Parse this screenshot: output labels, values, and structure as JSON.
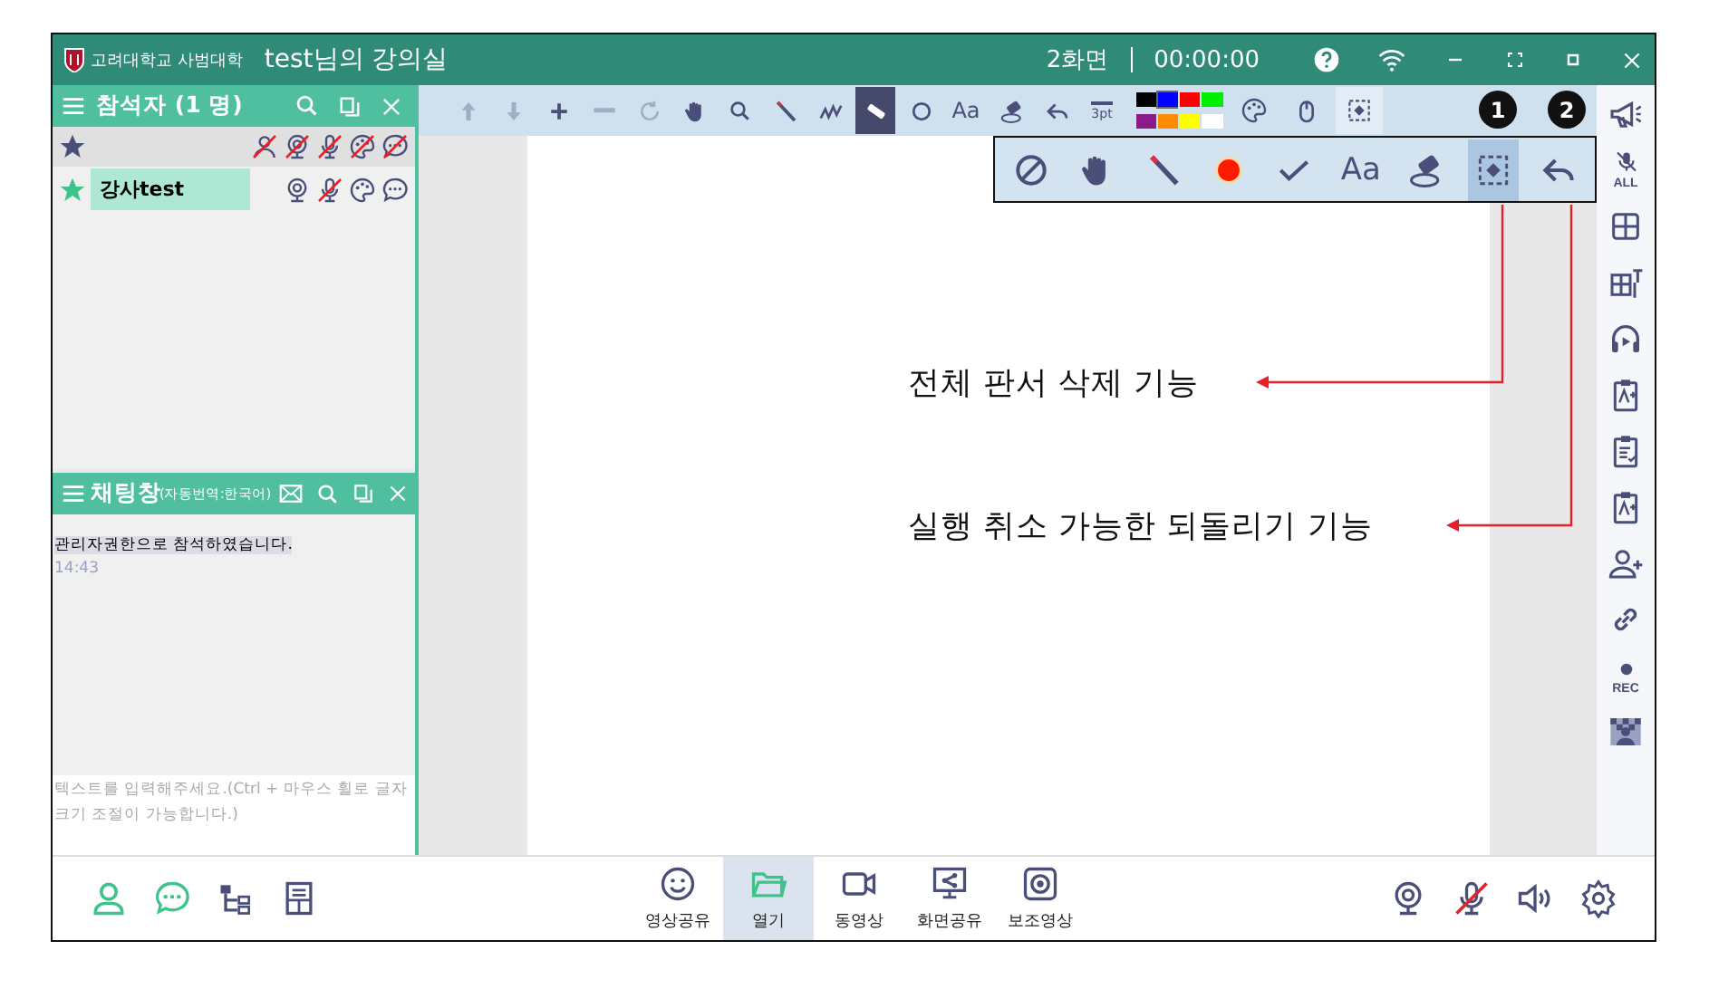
{
  "window": {
    "logo_text": "고려대학교 사범대학",
    "title": "test님의 강의실",
    "screen_count": "2화면",
    "timer": "00:00:00"
  },
  "participants": {
    "title": "참석자 (1 명)",
    "members": [
      {
        "name": "강사test",
        "selected": true,
        "mic_muted": true
      }
    ]
  },
  "chat": {
    "title": "채팅창",
    "subtitle": "(자동번역:한국어)",
    "messages": [
      {
        "text": "관리자권한으로 참석하였습니다.",
        "time": "14:43"
      }
    ],
    "placeholder": "텍스트를 입력해주세요.(Ctrl + 마우스 휠로 글자 크기 조절이 가능합니다.)"
  },
  "toolbar": {
    "tools": [
      {
        "kind": "up",
        "disabled": true,
        "selected": false
      },
      {
        "kind": "down",
        "disabled": true,
        "selected": false
      },
      {
        "kind": "plus",
        "disabled": false,
        "selected": false
      },
      {
        "kind": "minus",
        "disabled": true,
        "selected": false
      },
      {
        "kind": "rotate",
        "disabled": true,
        "selected": false
      },
      {
        "kind": "hand",
        "disabled": false,
        "selected": false
      },
      {
        "kind": "zoom",
        "disabled": false,
        "selected": false
      },
      {
        "kind": "pen",
        "disabled": false,
        "selected": false
      },
      {
        "kind": "squiggle",
        "disabled": false,
        "selected": false
      },
      {
        "kind": "highlighter",
        "disabled": false,
        "selected": true
      },
      {
        "kind": "circle",
        "disabled": false,
        "selected": false
      },
      {
        "kind": "text",
        "label": "Aa",
        "disabled": false,
        "selected": false
      },
      {
        "kind": "eraser",
        "disabled": false,
        "selected": false
      },
      {
        "kind": "undo",
        "disabled": false,
        "selected": false
      },
      {
        "kind": "width",
        "label": "3pt",
        "disabled": false,
        "selected": false
      }
    ],
    "colors": [
      {
        "color": "#000000",
        "selected": false
      },
      {
        "color": "#0000ff",
        "selected": true
      },
      {
        "color": "#ff0000",
        "selected": false
      },
      {
        "color": "#00ee00",
        "selected": false
      },
      {
        "color": "#8b1a8b",
        "selected": false
      },
      {
        "color": "#ff8c00",
        "selected": false
      },
      {
        "color": "#ffff00",
        "selected": false
      },
      {
        "color": "#ffffff",
        "selected": false
      }
    ],
    "extra": [
      {
        "kind": "palette",
        "selected": false
      },
      {
        "kind": "mouse",
        "selected": false
      },
      {
        "kind": "select",
        "selected": true
      }
    ]
  },
  "popup": {
    "tools": [
      {
        "kind": "cancel",
        "selected": false
      },
      {
        "kind": "hand",
        "selected": false
      },
      {
        "kind": "pen",
        "selected": false
      },
      {
        "kind": "reddot",
        "selected": false
      },
      {
        "kind": "check",
        "selected": false
      },
      {
        "kind": "text",
        "label": "Aa",
        "selected": false
      },
      {
        "kind": "eraser",
        "selected": false
      },
      {
        "kind": "select",
        "selected": true
      },
      {
        "kind": "undo",
        "selected": false
      }
    ],
    "badges": [
      "1",
      "2"
    ]
  },
  "callouts": [
    {
      "text": "전체 판서 삭제 기능"
    },
    {
      "text": "실행 취소 가능한 되돌리기 기능"
    }
  ],
  "sidebar": [
    {
      "kind": "megaphone"
    },
    {
      "kind": "mic-off",
      "label": "ALL"
    },
    {
      "kind": "grid"
    },
    {
      "kind": "grid-pin"
    },
    {
      "kind": "headphone"
    },
    {
      "kind": "clipboard"
    },
    {
      "kind": "clipboard-list"
    },
    {
      "kind": "clipboard"
    },
    {
      "kind": "person-plus"
    },
    {
      "kind": "link"
    },
    {
      "kind": "rec",
      "label": "REC"
    },
    {
      "kind": "checker"
    }
  ],
  "bottom": {
    "left": [
      {
        "kind": "person"
      },
      {
        "kind": "chat"
      },
      {
        "kind": "tree"
      },
      {
        "kind": "calculator"
      }
    ],
    "center": [
      {
        "kind": "smile",
        "label": "영상공유",
        "selected": false
      },
      {
        "kind": "folder",
        "label": "열기",
        "selected": true
      },
      {
        "kind": "video",
        "label": "동영상",
        "selected": false
      },
      {
        "kind": "share",
        "label": "화면공유",
        "selected": false
      },
      {
        "kind": "camera",
        "label": "보조영상",
        "selected": false
      }
    ],
    "right": [
      {
        "kind": "webcam",
        "muted": false
      },
      {
        "kind": "mic",
        "muted": true
      },
      {
        "kind": "speaker",
        "muted": false
      },
      {
        "kind": "gear",
        "muted": false
      }
    ]
  }
}
